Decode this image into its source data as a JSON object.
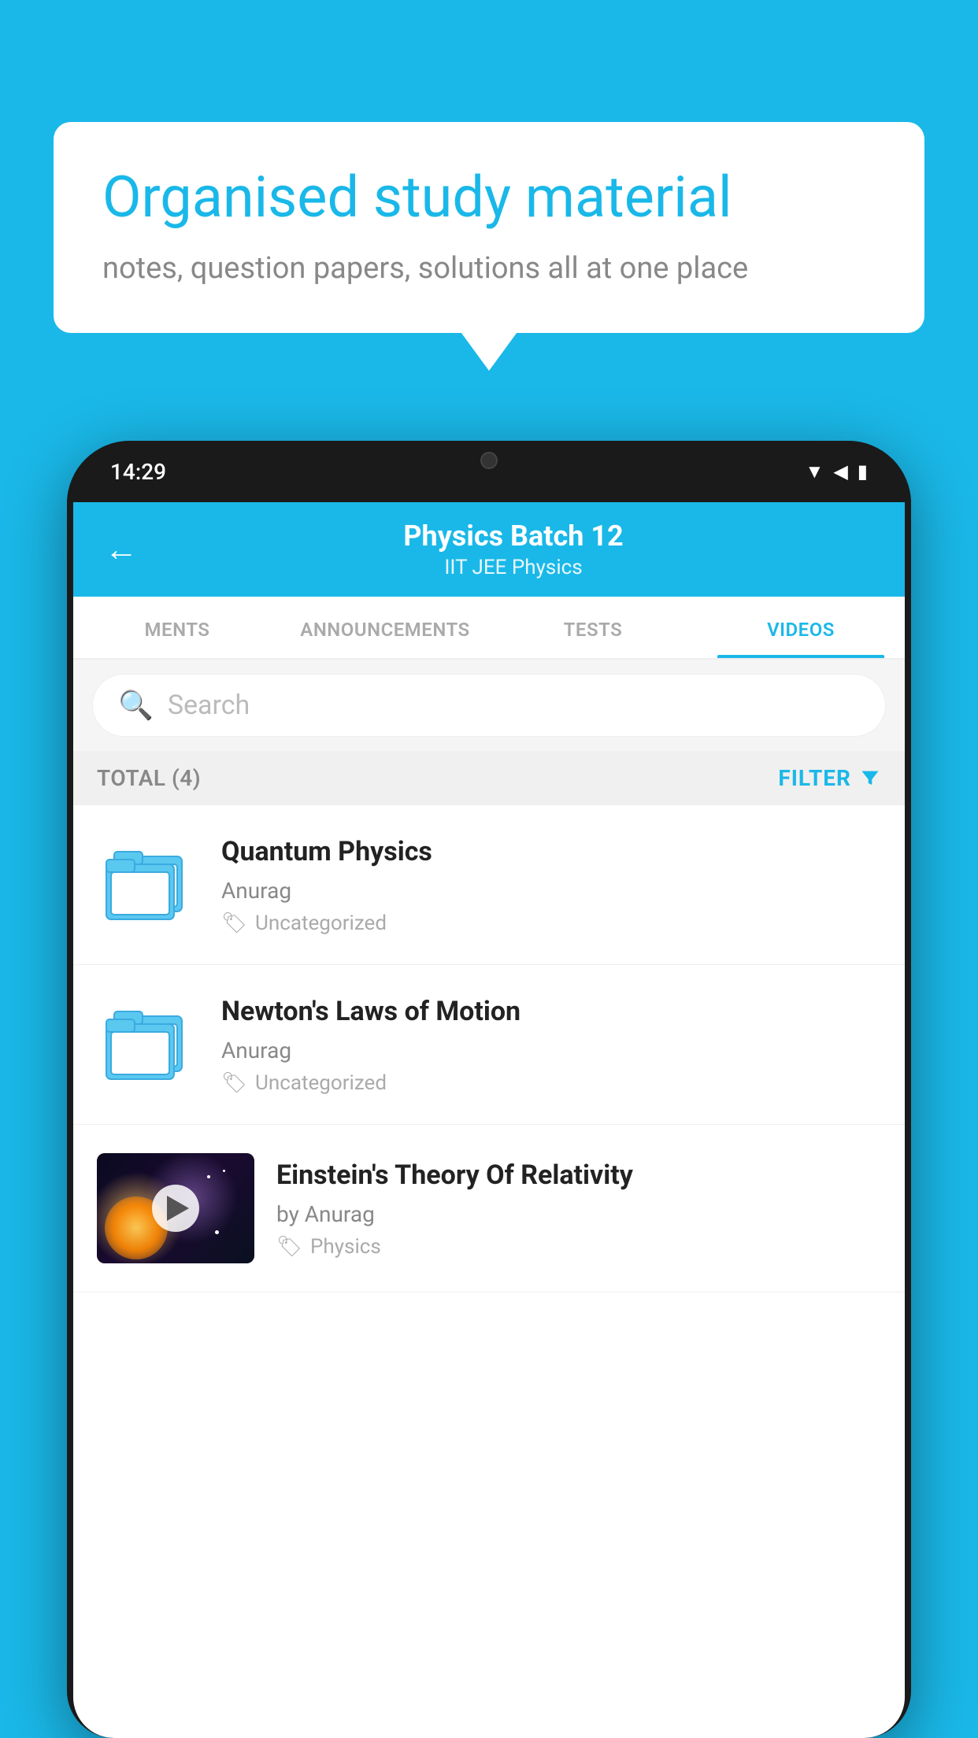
{
  "background_color": "#1ab8e8",
  "speech_bubble": {
    "title": "Organised study material",
    "subtitle": "notes, question papers, solutions all at one place"
  },
  "phone": {
    "status_bar": {
      "time": "14:29"
    },
    "header": {
      "title": "Physics Batch 12",
      "subtitle": "IIT JEE   Physics",
      "back_label": "←"
    },
    "tabs": [
      {
        "label": "MENTS",
        "active": false
      },
      {
        "label": "ANNOUNCEMENTS",
        "active": false
      },
      {
        "label": "TESTS",
        "active": false
      },
      {
        "label": "VIDEOS",
        "active": true
      }
    ],
    "search": {
      "placeholder": "Search"
    },
    "filter_row": {
      "total_label": "TOTAL (4)",
      "filter_label": "FILTER"
    },
    "videos": [
      {
        "id": 1,
        "title": "Quantum Physics",
        "author": "Anurag",
        "tag": "Uncategorized",
        "type": "folder"
      },
      {
        "id": 2,
        "title": "Newton's Laws of Motion",
        "author": "Anurag",
        "tag": "Uncategorized",
        "type": "folder"
      },
      {
        "id": 3,
        "title": "Einstein's Theory Of Relativity",
        "author": "by Anurag",
        "tag": "Physics",
        "type": "video"
      }
    ]
  }
}
